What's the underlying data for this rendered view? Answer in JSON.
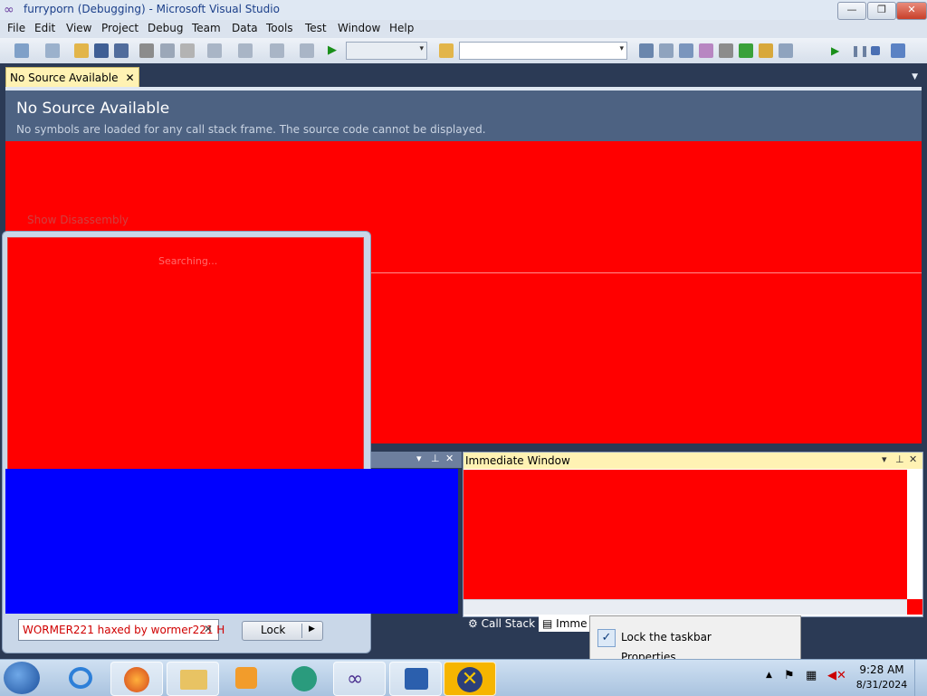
{
  "window": {
    "title": "furryporn (Debugging) - Microsoft Visual Studio"
  },
  "menu": [
    "File",
    "Edit",
    "View",
    "Project",
    "Debug",
    "Team",
    "Data",
    "Tools",
    "Test",
    "Window",
    "Help"
  ],
  "document_tab": {
    "label": "No Source Available",
    "close": "✕"
  },
  "no_source": {
    "heading": "No Source Available",
    "message": "No symbols are loaded for any call stack frame. The source code cannot be displayed."
  },
  "links": {
    "show_disassembly": "Show Disassembly"
  },
  "popup": {
    "status": "Searching...",
    "input_value": "WORMER221 haxed by wormer221 H",
    "lock_label": "Lock"
  },
  "immediate_window": {
    "title": "Immediate Window"
  },
  "bottom_tabs": {
    "call_stack": "Call Stack",
    "immediate": "Imme"
  },
  "context_menu": {
    "lock_taskbar": "Lock the taskbar",
    "properties": "Properties"
  },
  "clock": {
    "time": "9:28 AM",
    "date": "8/31/2024"
  },
  "colors": {
    "red": "#ff0000",
    "blue": "#0000ff",
    "accent": "#4d6282"
  },
  "icons": [
    "visual-studio-logo",
    "minimize-icon",
    "maximize-icon",
    "close-icon",
    "ie-icon",
    "firefox-icon",
    "folder-icon",
    "media-player-icon",
    "chat-icon",
    "visual-studio-icon",
    "debugger-icon",
    "network-x-icon"
  ]
}
